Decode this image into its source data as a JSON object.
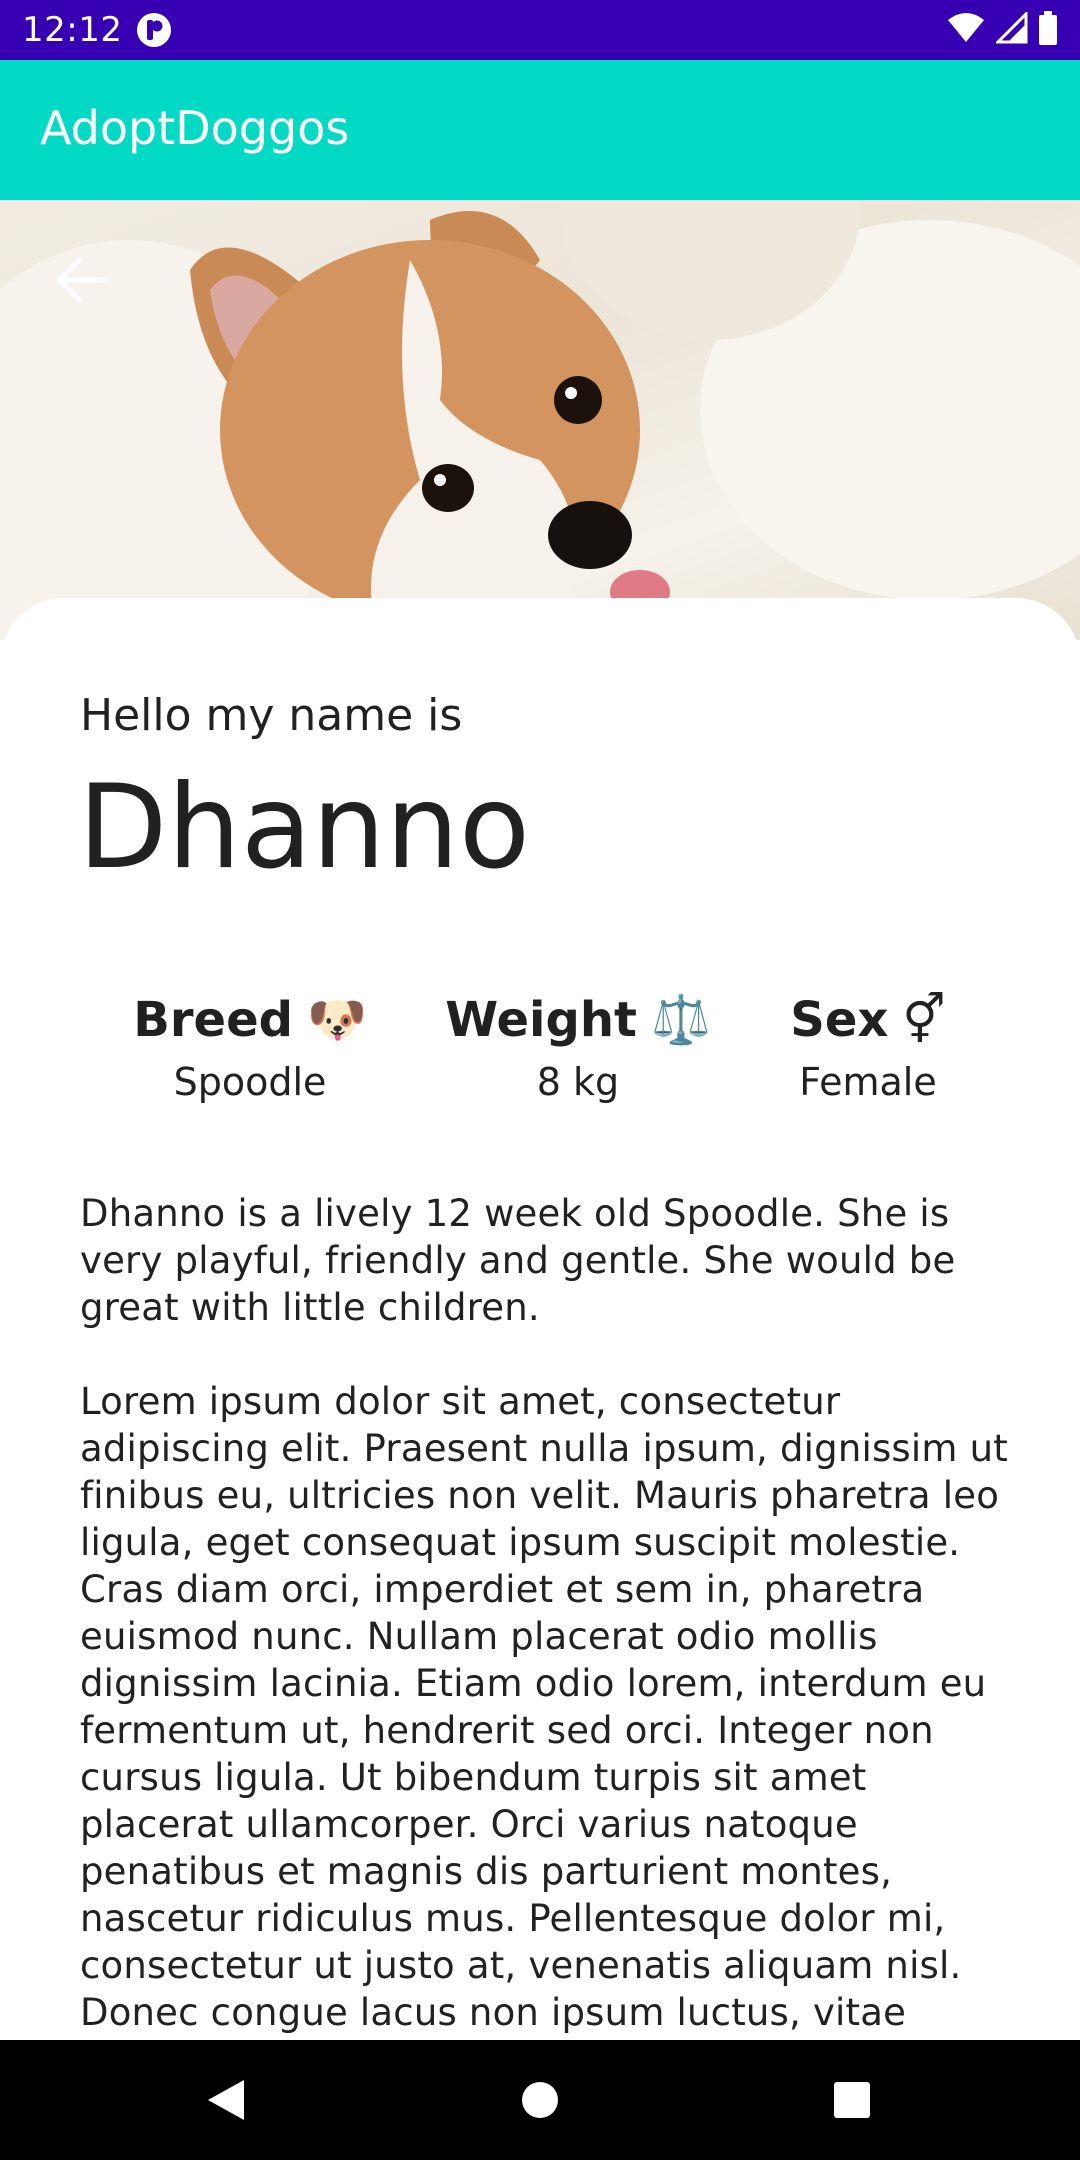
{
  "status_bar": {
    "time": "12:12",
    "icons": [
      "notification-icon",
      "wifi-icon",
      "signal-icon",
      "battery-icon"
    ]
  },
  "app_bar": {
    "title": "AdoptDoggos",
    "color": "#03dac5"
  },
  "hero": {
    "back_icon": "arrow-back-icon"
  },
  "dog": {
    "greeting": "Hello my name is",
    "name": "Dhanno",
    "attributes": [
      {
        "title": "Breed",
        "emoji": "🐶",
        "value": "Spoodle"
      },
      {
        "title": "Weight",
        "emoji": "⚖️",
        "value": "8 kg"
      },
      {
        "title": "Sex",
        "emoji": "⚥",
        "value": "Female"
      }
    ],
    "description": [
      "Dhanno is a lively 12 week old Spoodle. She is very playful, friendly and gentle. She would be great with little children.",
      "Lorem ipsum dolor sit amet, consectetur adipiscing elit. Praesent nulla ipsum, dignissim ut finibus eu, ultricies non velit. Mauris pharetra leo ligula, eget consequat ipsum suscipit molestie. Cras diam orci, imperdiet et sem in, pharetra euismod nunc. Nullam placerat odio mollis dignissim lacinia. Etiam odio lorem, interdum eu fermentum ut, hendrerit sed orci. Integer non cursus ligula. Ut bibendum turpis sit amet placerat ullamcorper. Orci varius natoque penatibus et magnis dis parturient montes, nascetur ridiculus mus. Pellentesque dolor mi, consectetur ut justo at, venenatis aliquam nisl. Donec congue lacus non ipsum luctus, vitae"
    ]
  },
  "nav_bar": {
    "icons": [
      "nav-back-icon",
      "nav-home-icon",
      "nav-recents-icon"
    ]
  }
}
